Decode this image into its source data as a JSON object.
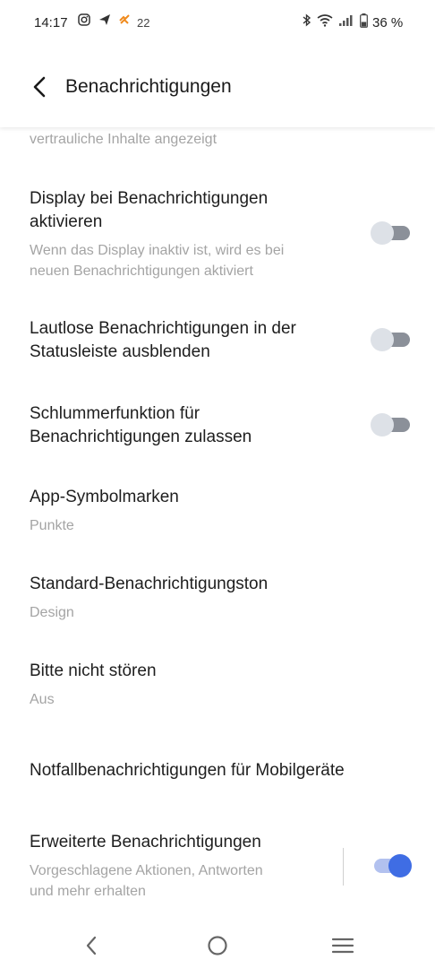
{
  "status_bar": {
    "time": "14:17",
    "notification_count": "22",
    "battery": "36 %",
    "icons": [
      "instagram-icon",
      "send-icon",
      "app-heart-icon",
      "bluetooth-icon",
      "wifi-icon",
      "signal-icon",
      "battery-icon"
    ]
  },
  "header": {
    "title": "Benachrichtigungen",
    "back_icon": "back-arrow-icon"
  },
  "settings": {
    "partial": {
      "subtitle": "vertrauliche Inhalte angezeigt"
    },
    "display_wake": {
      "title_line1": "Display bei Benachrichtigungen",
      "title_line2": "aktivieren",
      "subtitle_line1": "Wenn das Display inaktiv ist, wird es bei",
      "subtitle_line2": "neuen Benachrichtigungen aktiviert",
      "enabled": false
    },
    "silent_hide": {
      "title_line1": "Lautlose Benachrichtigungen in der",
      "title_line2": "Statusleiste ausblenden",
      "enabled": false
    },
    "snooze": {
      "title_line1": "Schlummerfunktion für",
      "title_line2": "Benachrichtigungen zulassen",
      "enabled": false
    },
    "badges": {
      "title": "App-Symbolmarken",
      "value": "Punkte"
    },
    "default_sound": {
      "title": "Standard-Benachrichtigungston",
      "value": "Design"
    },
    "dnd": {
      "title": "Bitte nicht stören",
      "value": "Aus"
    },
    "emergency": {
      "title": "Notfallbenachrichtigungen für Mobilgeräte"
    },
    "enhanced": {
      "title": "Erweiterte Benachrichtigungen",
      "subtitle_line1": "Vorgeschlagene Aktionen, Antworten",
      "subtitle_line2": "und mehr erhalten",
      "enabled": true
    }
  },
  "nav_bar": {
    "icons": [
      "nav-back-icon",
      "nav-home-icon",
      "nav-menu-icon"
    ]
  },
  "colors": {
    "accent": "#3f6de4",
    "toggle_off_track": "#8b9099",
    "toggle_off_thumb": "#dde1e7",
    "secondary_text": "#a4a4a4"
  }
}
